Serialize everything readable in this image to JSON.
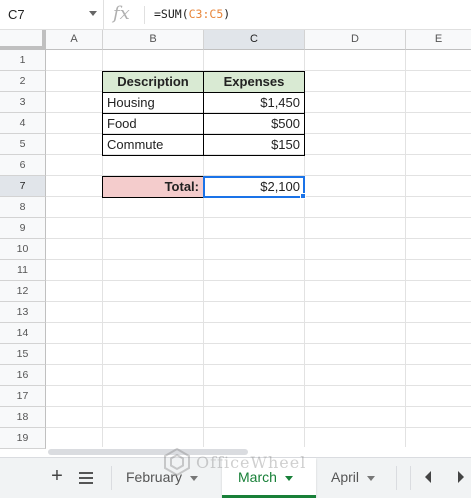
{
  "formula_bar": {
    "name_box": "C7",
    "fx_label": "fx",
    "formula_prefix": "=SUM(",
    "formula_range": "C3:C5",
    "formula_suffix": ")"
  },
  "columns": [
    "A",
    "B",
    "C",
    "D",
    "E"
  ],
  "selected_column": "C",
  "rows": [
    "1",
    "2",
    "3",
    "4",
    "5",
    "6",
    "7",
    "8",
    "9",
    "10",
    "11",
    "12",
    "13",
    "14",
    "15",
    "16",
    "17",
    "18",
    "19"
  ],
  "selected_row": "7",
  "table": {
    "header_description": "Description",
    "header_expenses": "Expenses",
    "rows": [
      {
        "description": "Housing",
        "expense": "$1,450"
      },
      {
        "description": "Food",
        "expense": "$500"
      },
      {
        "description": "Commute",
        "expense": "$150"
      }
    ],
    "total_label": "Total:",
    "total_value": "$2,100"
  },
  "sheet_tabs": [
    {
      "label": "February",
      "active": false
    },
    {
      "label": "March",
      "active": true
    },
    {
      "label": "April",
      "active": false
    }
  ],
  "watermark": "OfficeWheel",
  "colors": {
    "header_fill": "#d9ead3",
    "total_fill": "#f4cccc",
    "selection": "#1a73e8",
    "active_tab": "#188038",
    "formula_range": "#e8863a"
  },
  "icons": [
    "chevron-down-icon",
    "fx-icon",
    "add-sheet-icon",
    "all-sheets-menu-icon",
    "tab-caret-icon",
    "scroll-left-icon",
    "scroll-right-icon",
    "watermark-logo-icon"
  ]
}
